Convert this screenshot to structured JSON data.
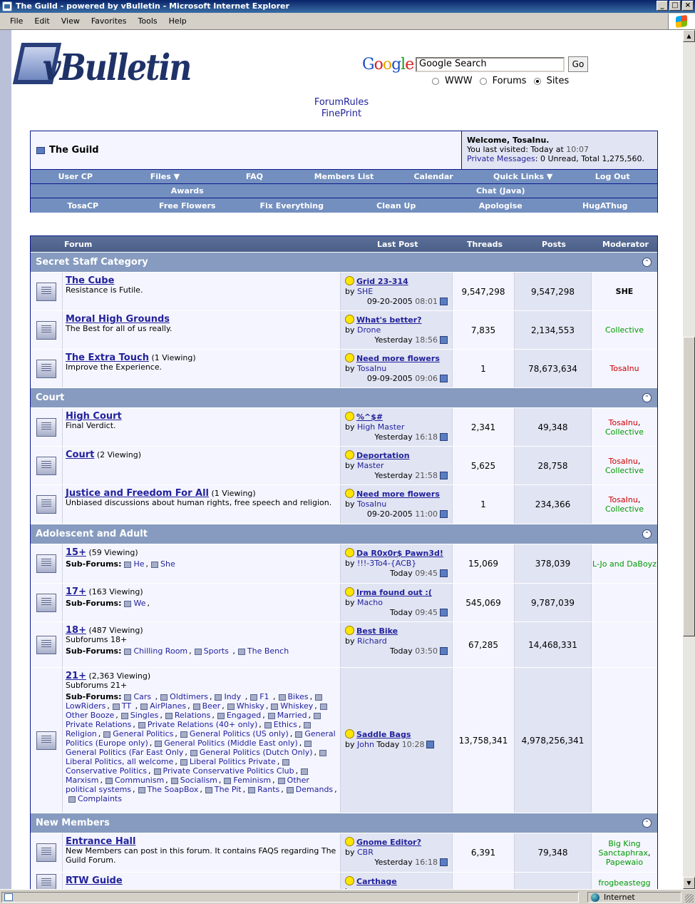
{
  "window": {
    "title": "The Guild - powered by vBulletin - Microsoft Internet Explorer",
    "menu": [
      "File",
      "Edit",
      "View",
      "Favorites",
      "Tools",
      "Help"
    ]
  },
  "header": {
    "logo_text": "vBulletin",
    "google_logo": "Google",
    "search_value": "Google Search",
    "go_label": "Go",
    "radios": [
      {
        "label": "WWW",
        "selected": false
      },
      {
        "label": "Forums",
        "selected": false
      },
      {
        "label": "Sites",
        "selected": true
      }
    ],
    "links": [
      "ForumRules",
      "FinePrint"
    ]
  },
  "navbar": {
    "breadcrumb": "The Guild",
    "welcome": "Welcome, TosaInu.",
    "last_visited_prefix": "You last visited: Today at ",
    "last_visited_time": "10:07",
    "pm_link": "Private Messages",
    "pm_text": ": 0 Unread, Total 1,275,560.",
    "row1": [
      "User CP",
      "Files ▼",
      "FAQ",
      "Members List",
      "Calendar",
      "Quick Links ▼",
      "Log Out"
    ],
    "row2": [
      "Awards",
      "Chat (Java)"
    ],
    "row3": [
      "TosaCP",
      "Free Flowers",
      "Fix Everything",
      "Clean Up",
      "Apologise",
      "HugAThug"
    ]
  },
  "table_headers": {
    "forum": "Forum",
    "last_post": "Last Post",
    "threads": "Threads",
    "posts": "Posts",
    "moderator": "Moderator"
  },
  "categories": [
    {
      "name": "Secret Staff Category",
      "forums": [
        {
          "name": "The Cube",
          "viewing": "",
          "desc": "Resistance is Futile.",
          "lp_title": "Grid 23-314",
          "lp_user": "SHE",
          "lp_date": "09-20-2005",
          "lp_time": "08:01",
          "threads": "9,547,298",
          "posts": "9,547,298",
          "mods": [
            "SHE"
          ]
        },
        {
          "name": "Moral High Grounds",
          "viewing": "",
          "desc": "The Best for all of us really.",
          "lp_title": "What's better?",
          "lp_user": "Drone",
          "lp_date": "Yesterday",
          "lp_time": "18:56",
          "threads": "7,835",
          "posts": "2,134,553",
          "mods": [
            "Collective"
          ]
        },
        {
          "name": "The Extra Touch",
          "viewing": "(1 Viewing)",
          "desc": "Improve the Experience.",
          "lp_title": "Need more flowers",
          "lp_user": "TosaInu",
          "lp_date": "09-09-2005",
          "lp_time": "09:06",
          "threads": "1",
          "posts": "78,673,634",
          "mods": [
            "TosaInu"
          ]
        }
      ]
    },
    {
      "name": "Court",
      "forums": [
        {
          "name": "High Court",
          "viewing": "",
          "desc": "Final Verdict.",
          "lp_title": "%^$#",
          "lp_user": "High Master",
          "lp_date": "Yesterday",
          "lp_time": "16:18",
          "threads": "2,341",
          "posts": "49,348",
          "mods": [
            "TosaInu",
            "Collective"
          ]
        },
        {
          "name": "Court",
          "viewing": "(2 Viewing)",
          "desc": "",
          "lp_title": "Deportation",
          "lp_user": "Master",
          "lp_date": "Yesterday",
          "lp_time": "21:58",
          "threads": "5,625",
          "posts": "28,758",
          "mods": [
            "TosaInu",
            "Collective"
          ]
        },
        {
          "name": "Justice and Freedom For All",
          "viewing": "(1 Viewing)",
          "desc": "Unbiased discussions about human rights, free speech and religion.",
          "lp_title": "Need more flowers",
          "lp_user": "TosaInu",
          "lp_date": "09-20-2005",
          "lp_time": "11:00",
          "threads": "1",
          "posts": "234,366",
          "mods": [
            "TosaInu",
            "Collective"
          ]
        }
      ]
    },
    {
      "name": "Adolescent and Adult",
      "forums": [
        {
          "name": "15+",
          "viewing": "(59 Viewing)",
          "sub_label": "Sub-Forums:",
          "subs": [
            "He",
            "She"
          ],
          "lp_title": "Da R0x0r$ Pawn3d!",
          "lp_user": "!!!-3To4-{ACB}",
          "lp_date": "Today",
          "lp_time": "09:45",
          "threads": "15,069",
          "posts": "378,039",
          "mods": [
            "L-Jo and DaBoyz"
          ]
        },
        {
          "name": "17+",
          "viewing": "(163 Viewing)",
          "sub_label": "Sub-Forums:",
          "subs": [
            "We"
          ],
          "lp_title": "Irma found out :(",
          "lp_user": "Macho",
          "lp_date": "Today",
          "lp_time": "09:45",
          "threads": "545,069",
          "posts": "9,787,039",
          "mods": []
        },
        {
          "name": "18+",
          "viewing": "(487 Viewing)",
          "desc": "Subforums 18+",
          "sub_label": "Sub-Forums:",
          "subs": [
            "Chilling Room",
            "Sports ",
            "The Bench"
          ],
          "lp_title": "Best Bike",
          "lp_user": "Richard",
          "lp_date": "Today",
          "lp_time": "03:50",
          "threads": "67,285",
          "posts": "14,468,331",
          "mods": []
        },
        {
          "name": "21+",
          "viewing": "(2,363 Viewing)",
          "desc": "Subforums 21+",
          "sub_label": "Sub-Forums:",
          "subs": [
            "Cars ",
            "Oldtimers",
            "Indy ",
            "F1 ",
            "Bikes",
            "LowRiders",
            "TT ",
            "AirPlanes",
            "Beer",
            "Whisky",
            "Whiskey",
            "Other Booze",
            "Singles",
            "Relations",
            "Engaged",
            "Married",
            "Private Relations",
            "Private Relations (40+ only)",
            "Ethics",
            "Religion",
            "General Politics",
            "General Politics (US only)",
            "General Politics (Europe only)",
            "General Politics (Middle East only)",
            "General Politics (Far East Only",
            "General Politics (Dutch Only)",
            "Liberal Politics, all welcome",
            "Liberal Politics Private",
            "Conservative Politics",
            "Private Conservative Politics Club",
            "Marxism",
            "Communism",
            "Socialism",
            "Feminism",
            "Other political systems",
            "The SoapBox",
            "The Pit",
            "Rants",
            "Demands",
            "Complaints"
          ],
          "lp_title": "Saddle Bags",
          "lp_user": "John",
          "lp_date": "Today",
          "lp_time": "10:28",
          "threads": "13,758,341",
          "posts": "4,978,256,341",
          "mods": []
        }
      ]
    },
    {
      "name": "New Members",
      "forums": [
        {
          "name": "Entrance Hall",
          "viewing": "",
          "desc": "New Members can post in this forum. It contains FAQS regarding The Guild Forum.",
          "lp_title": "Gnome Editor?",
          "lp_user": "CBR",
          "lp_date": "Yesterday",
          "lp_time": "16:18",
          "threads": "6,391",
          "posts": "79,348",
          "mods": [
            "Big King Sanctaphrax",
            "Papewaio"
          ]
        },
        {
          "name": "RTW Guide",
          "viewing": "",
          "desc": "",
          "lp_title": "Carthage",
          "lp_user": "",
          "lp_date": "",
          "lp_time": "",
          "threads": "",
          "posts": "",
          "mods": [
            "frogbeastegg"
          ]
        }
      ]
    }
  ],
  "status": {
    "zone": "Internet"
  },
  "colors": {
    "title_bar": "#0a246a",
    "nav_bg": "#738fbf",
    "category_bg": "#869bbf",
    "row_light": "#f5f5ff",
    "row_alt": "#e1e4f2",
    "link": "#22229C",
    "mod_red": "#cc0000",
    "mod_green": "#009900"
  }
}
